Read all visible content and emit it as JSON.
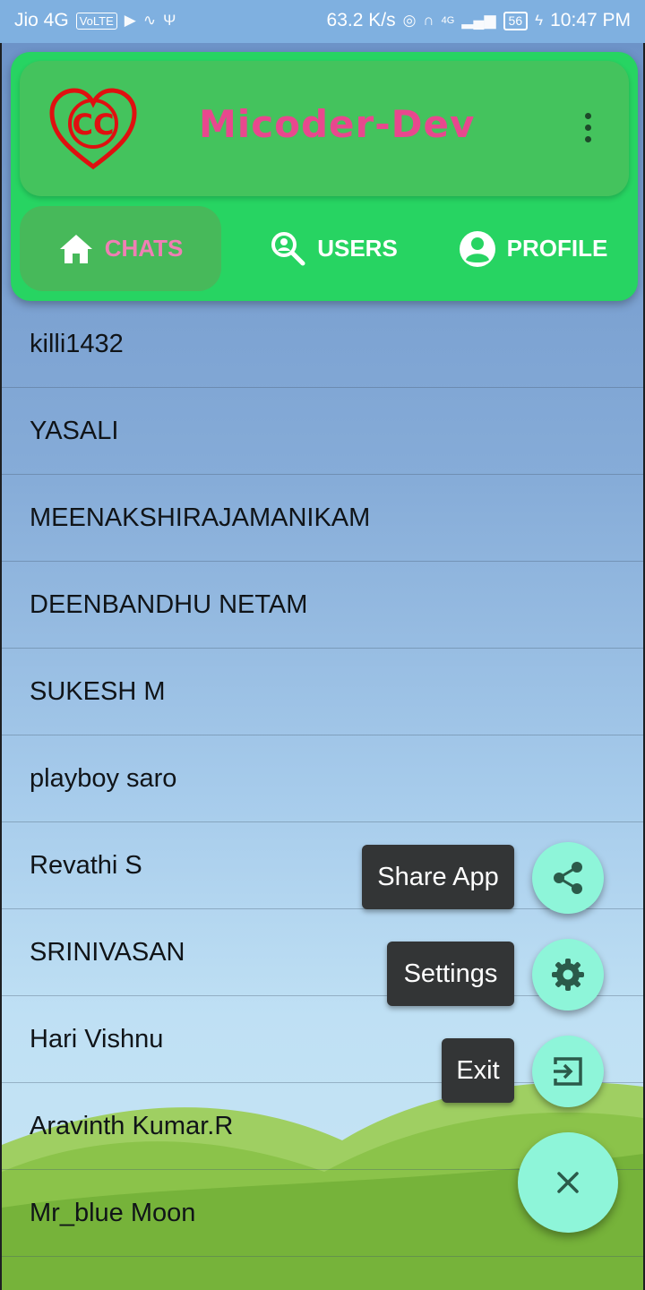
{
  "status_bar": {
    "carrier": "Jio 4G",
    "volte": "VoLTE",
    "speed": "63.2 K/s",
    "network": "4G",
    "battery": "56",
    "time": "10:47 PM"
  },
  "app": {
    "logo_text": "CC",
    "title": "Micoder-Dev"
  },
  "tabs": [
    {
      "label": "CHATS",
      "icon": "home-icon",
      "active": true
    },
    {
      "label": "USERS",
      "icon": "search-person-icon",
      "active": false
    },
    {
      "label": "PROFILE",
      "icon": "account-circle-icon",
      "active": false
    }
  ],
  "chats": [
    {
      "name": "killi1432"
    },
    {
      "name": "YASALI"
    },
    {
      "name": "MEENAKSHIRAJAMANIKAM"
    },
    {
      "name": "DEENBANDHU NETAM"
    },
    {
      "name": "SUKESH M"
    },
    {
      "name": "playboy saro"
    },
    {
      "name": "Revathi S"
    },
    {
      "name": "SRINIVASAN"
    },
    {
      "name": "Hari Vishnu"
    },
    {
      "name": "Aravinth Kumar.R"
    },
    {
      "name": "Mr_blue Moon"
    }
  ],
  "fab_menu": {
    "share_label": "Share App",
    "settings_label": "Settings",
    "exit_label": "Exit"
  },
  "colors": {
    "header_green": "#27d462",
    "title_pink": "#e8488e",
    "fab_mint": "#8ef5d9",
    "label_dark": "#333536"
  }
}
